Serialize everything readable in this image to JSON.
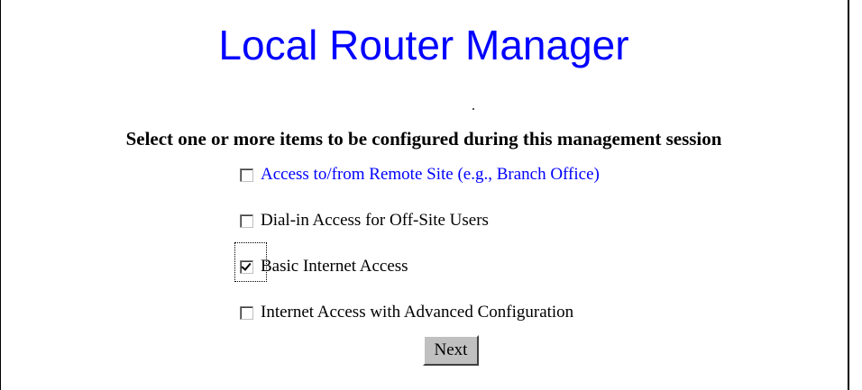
{
  "page": {
    "title": "Local Router Manager",
    "instruction": "Select one or more items to be configured during this management session"
  },
  "options": [
    {
      "label": "Access to/from Remote Site (e.g., Branch Office)",
      "checked": false,
      "link": true
    },
    {
      "label": "Dial-in Access for Off-Site Users",
      "checked": false,
      "link": false
    },
    {
      "label": "Basic Internet Access",
      "checked": true,
      "link": false
    },
    {
      "label": "Internet Access with Advanced Configuration",
      "checked": false,
      "link": false
    }
  ],
  "actions": {
    "next_label": "Next"
  },
  "colors": {
    "title": "#0000ff",
    "link": "#0000ff",
    "button_face": "#c0c0c0"
  }
}
